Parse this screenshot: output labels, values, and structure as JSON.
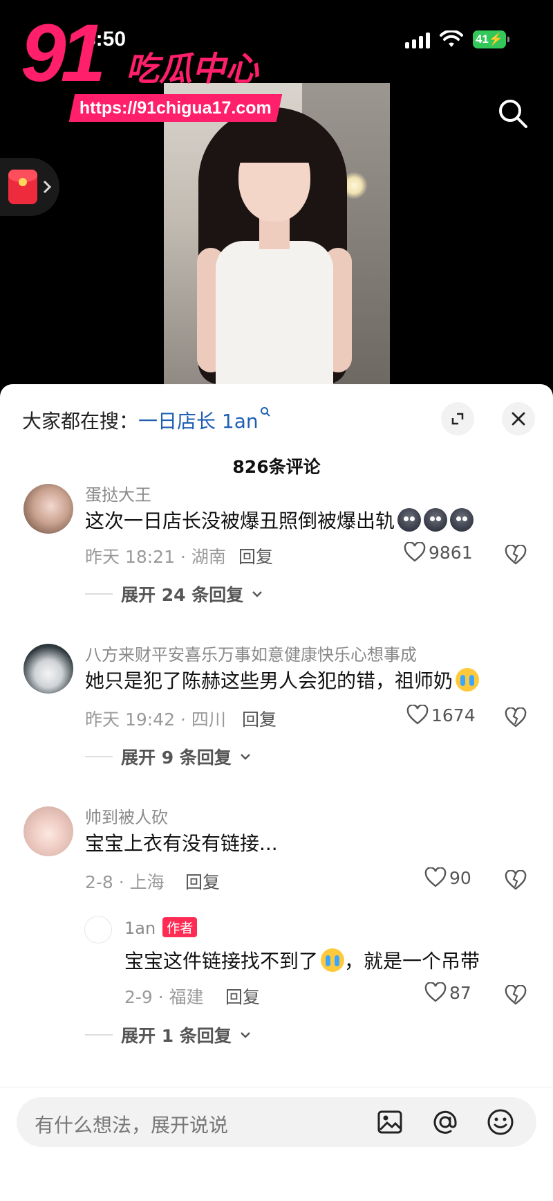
{
  "status": {
    "time": "3:50",
    "battery": "41"
  },
  "watermark": {
    "number": "91",
    "name": "吃瓜中心",
    "url": "https://91chigua17.com"
  },
  "sheet": {
    "search_prefix": "大家都在搜：",
    "search_link": "一日店长 1an",
    "comment_count": "826条评论"
  },
  "comments": [
    {
      "username": "蛋挞大王",
      "text": "这次一日店长没被爆丑照倒被爆出轨",
      "meta": "昨天 18:21 · 湖南",
      "reply": "回复",
      "likes": "9861",
      "expand": "展开 24 条回复"
    },
    {
      "username": "八方来财平安喜乐万事如意健康快乐心想事成",
      "text": "她只是犯了陈赫这些男人会犯的错，祖师奶",
      "meta": "昨天 19:42 · 四川",
      "reply": "回复",
      "likes": "1674",
      "expand": "展开 9 条回复"
    },
    {
      "username": "帅到被人砍",
      "text": "宝宝上衣有没有链接...",
      "meta": "2-8 · 上海",
      "reply": "回复",
      "likes": "90"
    }
  ],
  "sub_reply": {
    "username": "1an",
    "tag": "作者",
    "text_a": "宝宝这件链接找不到了",
    "text_b": "，就是一个吊带",
    "meta": "2-9 · 福建",
    "reply": "回复",
    "likes": "87",
    "expand": "展开 1 条回复"
  },
  "input": {
    "placeholder": "有什么想法，展开说说"
  },
  "colors": {
    "accent_watermark": "#ff1f6a",
    "link": "#1f5fb3",
    "author_tag": "#fe2c55",
    "battery": "#34c759"
  }
}
